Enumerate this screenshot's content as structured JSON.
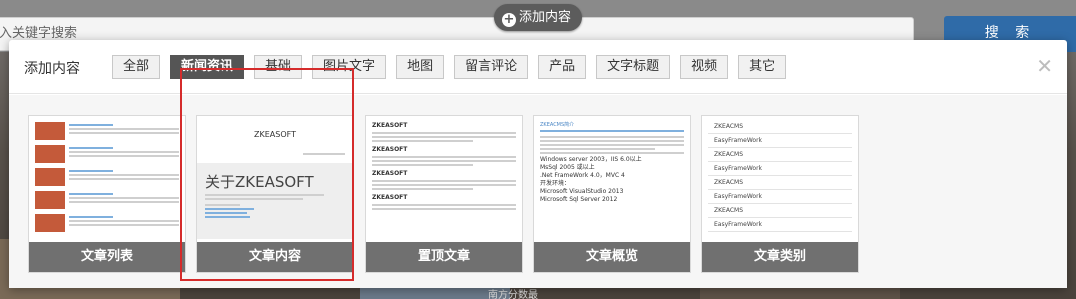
{
  "background": {
    "search_placeholder": "入关键字搜索",
    "search_button": "搜 索",
    "caption": "南方分数最"
  },
  "add_pill": {
    "label": "添加内容",
    "icon": "plus-icon"
  },
  "modal": {
    "title": "添加内容",
    "filters": [
      "全部",
      "新闻资讯",
      "基础",
      "图片文字",
      "地图",
      "留言评论",
      "产品",
      "文字标题",
      "视频",
      "其它"
    ],
    "active_filter": "新闻资讯",
    "close_icon": "close-icon"
  },
  "cards": [
    {
      "label": "文章列表"
    },
    {
      "label": "文章内容",
      "selected": true,
      "thumb_site": "ZKEASOFT",
      "thumb_heading": "关于ZKEASOFT"
    },
    {
      "label": "置顶文章",
      "thumb_site": "ZKEASOFT"
    },
    {
      "label": "文章概览",
      "thumb_title": "ZKEACMS简介",
      "thumb_lines": [
        "Windows server 2003，IIS 6.0以上",
        "MsSql 2005 或以上",
        ".Net FrameWork 4.0，MVC 4",
        "开发环境：",
        "Microsoft VisualStudio 2013",
        "Microsoft Sql Server 2012"
      ]
    },
    {
      "label": "文章类别",
      "thumb_items": [
        "ZKEACMS",
        "EasyFrameWork",
        "ZKEACMS",
        "EasyFrameWork",
        "ZKEACMS",
        "EasyFrameWork",
        "ZKEACMS",
        "EasyFrameWork"
      ]
    }
  ],
  "colors": {
    "active_filter_bg": "#555555",
    "selection_border": "#d52b2b",
    "search_button_bg": "#2f6ba8",
    "card_bar_bg": "#505050"
  }
}
